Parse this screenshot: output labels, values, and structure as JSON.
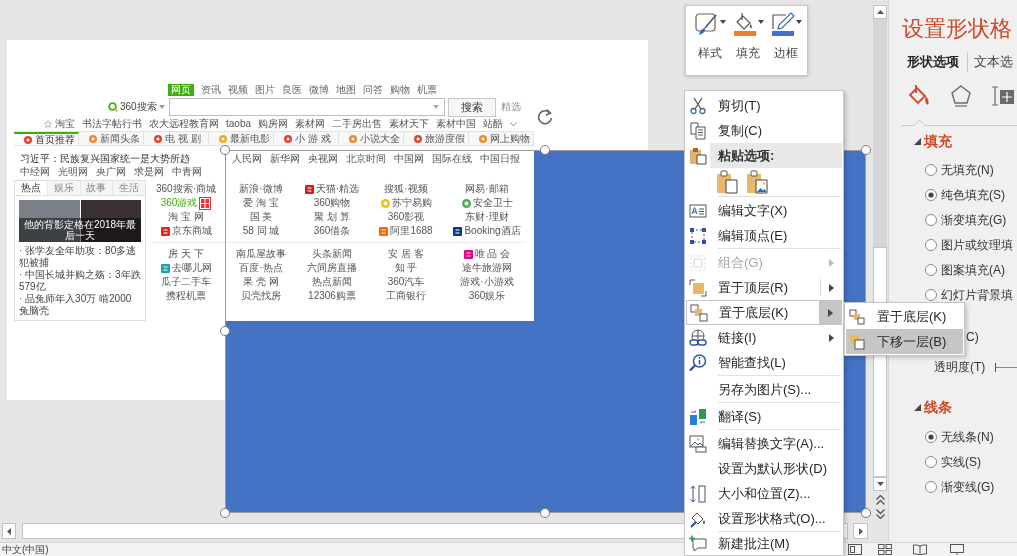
{
  "mini_toolbar": {
    "buttons": [
      {
        "kind": "style",
        "label": "样式"
      },
      {
        "kind": "fill",
        "label": "填充"
      },
      {
        "kind": "outline",
        "label": "边框"
      }
    ]
  },
  "slide": {
    "picture": {
      "nav_tabs": [
        {
          "label": "网页",
          "selected": true
        },
        {
          "label": "资讯",
          "selected": false
        },
        {
          "label": "视频",
          "selected": false
        },
        {
          "label": "图片",
          "selected": false
        },
        {
          "label": "良医",
          "selected": false
        },
        {
          "label": "微博",
          "selected": false
        },
        {
          "label": "地图",
          "selected": false
        },
        {
          "label": "问答",
          "selected": false
        },
        {
          "label": "购物",
          "selected": false
        },
        {
          "label": "机票",
          "selected": false
        }
      ],
      "search": {
        "logo": "360搜索",
        "button": "搜索",
        "side_link": "精选"
      },
      "hot_links": [
        "淘宝",
        "书法字帖行书",
        "农大远程教育网",
        "taoba",
        "购房网",
        "素材网",
        "二手房出售",
        "素材天下",
        "素材中国",
        "站酷"
      ],
      "channel_tabs": [
        {
          "label": "首页推荐",
          "selected": true
        },
        {
          "label": "新闻头条",
          "selected": false
        },
        {
          "label": "电 视 剧",
          "selected": false
        },
        {
          "label": "最新电影",
          "selected": false
        },
        {
          "label": "小 游 戏",
          "selected": false
        },
        {
          "label": "小说大全",
          "selected": false
        },
        {
          "label": "旅游度假",
          "selected": false
        },
        {
          "label": "网上购物",
          "selected": false
        }
      ],
      "headline": "习近平：民族复兴国家统一是大势所趋",
      "media_links": [
        "人民网",
        "新华网",
        "央视网",
        "北京时间",
        "中国网",
        "国际在线",
        "中国日报",
        "中经网",
        "光明网",
        "央广网",
        "求是网",
        "中青网"
      ],
      "news_tabs": [
        {
          "label": "热点",
          "selected": true
        },
        {
          "label": "娱乐",
          "selected": false
        },
        {
          "label": "故事",
          "selected": false
        },
        {
          "label": "生活",
          "selected": false
        }
      ],
      "photo_caption": "他的背影定格在2018年最后一天",
      "news_items": [
        "· 张学友全年助攻：80多逃犯被捕",
        "· 中国长城并购之殇：3年跌579亿",
        "· 品兔师年入30万 啃2000兔脑壳"
      ],
      "site_blocks": [
        [
          [
            {
              "label": "360搜索·商城",
              "highlighted": false
            },
            {
              "label": "新浪·微博",
              "highlighted": false
            },
            {
              "label": "天猫·精选",
              "highlighted": false
            },
            {
              "label": "搜狐·视频",
              "highlighted": false
            },
            {
              "label": "网易·邮箱",
              "highlighted": false
            }
          ],
          [
            {
              "label": "360游戏",
              "highlighted": true
            },
            {
              "label": "爱 淘 宝",
              "highlighted": false
            },
            {
              "label": "360购物",
              "highlighted": false
            },
            {
              "label": "苏宁易购",
              "highlighted": false
            },
            {
              "label": "安全卫士",
              "highlighted": false
            }
          ],
          [
            {
              "label": "淘 宝 网",
              "highlighted": false
            },
            {
              "label": "国 美",
              "highlighted": false
            },
            {
              "label": "聚 划 算",
              "highlighted": false
            },
            {
              "label": "360影视",
              "highlighted": false
            },
            {
              "label": "东财·理财",
              "highlighted": false
            }
          ],
          [
            {
              "label": "京东商城",
              "highlighted": false
            },
            {
              "label": "58 同 城",
              "highlighted": false
            },
            {
              "label": "360借条",
              "highlighted": false
            },
            {
              "label": "阿里1688",
              "highlighted": false
            },
            {
              "label": "Booking酒店",
              "highlighted": false
            }
          ]
        ],
        [
          [
            {
              "label": "房 天 下",
              "highlighted": false
            },
            {
              "label": "南瓜屋故事",
              "highlighted": false
            },
            {
              "label": "头条新闻",
              "highlighted": false
            },
            {
              "label": "安 居 客",
              "highlighted": false
            },
            {
              "label": "唯 品 会",
              "highlighted": false
            }
          ],
          [
            {
              "label": "去哪儿网",
              "highlighted": false
            },
            {
              "label": "百度·热点",
              "highlighted": false
            },
            {
              "label": "六间房直播",
              "highlighted": false
            },
            {
              "label": "知 乎",
              "highlighted": false
            },
            {
              "label": "途牛旅游网",
              "highlighted": false
            }
          ],
          [
            {
              "label": "瓜子二手车",
              "highlighted": false
            },
            {
              "label": "果 壳 网",
              "highlighted": false
            },
            {
              "label": "热点新闻",
              "highlighted": false
            },
            {
              "label": "360汽车",
              "highlighted": false
            },
            {
              "label": "游戏·小游戏",
              "highlighted": false
            }
          ],
          [
            {
              "label": "携程机票",
              "highlighted": false
            },
            {
              "label": "贝壳找房",
              "highlighted": false
            },
            {
              "label": "12306购票",
              "highlighted": false
            },
            {
              "label": "工商银行",
              "highlighted": false
            },
            {
              "label": "360娱乐",
              "highlighted": false
            }
          ]
        ]
      ]
    }
  },
  "context_menu": {
    "groups": [
      [
        {
          "kind": "command",
          "label": "剪切(T)",
          "disabled": false,
          "submenu": false,
          "expanded": false
        },
        {
          "kind": "command",
          "label": "复制(C)",
          "disabled": false,
          "submenu": false,
          "expanded": false
        },
        {
          "kind": "header",
          "label": "粘贴选项:"
        },
        {
          "kind": "paste_options"
        }
      ],
      [
        {
          "kind": "command",
          "label": "编辑文字(X)",
          "disabled": false,
          "submenu": false,
          "expanded": false
        },
        {
          "kind": "command",
          "label": "编辑顶点(E)",
          "disabled": false,
          "submenu": false,
          "expanded": false
        }
      ],
      [
        {
          "kind": "command",
          "label": "组合(G)",
          "disabled": true,
          "submenu": true,
          "expanded": false
        },
        {
          "kind": "split",
          "label": "置于顶层(R)",
          "disabled": false,
          "submenu": true,
          "expanded": false
        },
        {
          "kind": "split",
          "label": "置于底层(K)",
          "disabled": false,
          "submenu": true,
          "expanded": true
        },
        {
          "kind": "command",
          "label": "链接(I)",
          "disabled": false,
          "submenu": true,
          "expanded": false
        },
        {
          "kind": "command",
          "label": "智能查找(L)",
          "disabled": false,
          "submenu": false,
          "expanded": false
        }
      ],
      [
        {
          "kind": "command",
          "label": "另存为图片(S)...",
          "disabled": false,
          "submenu": false,
          "expanded": false
        }
      ],
      [
        {
          "kind": "command",
          "label": "翻译(S)",
          "disabled": false,
          "submenu": false,
          "expanded": false
        }
      ],
      [
        {
          "kind": "command",
          "label": "编辑替换文字(A)...",
          "disabled": false,
          "submenu": false,
          "expanded": false
        },
        {
          "kind": "command",
          "label": "设置为默认形状(D)",
          "disabled": false,
          "submenu": false,
          "expanded": false
        },
        {
          "kind": "command",
          "label": "大小和位置(Z)...",
          "disabled": false,
          "submenu": false,
          "expanded": false
        },
        {
          "kind": "command",
          "label": "设置形状格式(O)...",
          "disabled": false,
          "submenu": false,
          "expanded": false
        }
      ],
      [
        {
          "kind": "command",
          "label": "新建批注(M)",
          "disabled": false,
          "submenu": false,
          "expanded": false
        }
      ]
    ]
  },
  "submenu": {
    "items": [
      {
        "label": "置于底层(K)",
        "selected": false
      },
      {
        "label": "下移一层(B)",
        "selected": true
      }
    ]
  },
  "format_pane": {
    "title": "设置形状格",
    "tabs": [
      {
        "label": "形状选项",
        "selected": true
      },
      {
        "label": "文本选",
        "selected": false
      }
    ],
    "category_tabs": [
      {
        "selected": true
      },
      {
        "selected": false
      },
      {
        "selected": false
      }
    ],
    "sections": [
      {
        "title": "填充",
        "expanded": true,
        "options": [
          {
            "label": "无填充(N)",
            "selected": false
          },
          {
            "label": "纯色填充(S)",
            "selected": true
          },
          {
            "label": "渐变填充(G)",
            "selected": false
          },
          {
            "label": "图片或纹理填",
            "selected": false
          },
          {
            "label": "图案填充(A)",
            "selected": false
          },
          {
            "label": "幻灯片背景填",
            "selected": false
          }
        ],
        "controls": [
          {
            "kind": "color",
            "label": "C)"
          },
          {
            "kind": "slider",
            "label": "透明度(T)"
          }
        ]
      },
      {
        "title": "线条",
        "expanded": true,
        "options": [
          {
            "label": "无线条(N)",
            "selected": true
          },
          {
            "label": "实线(S)",
            "selected": false
          },
          {
            "label": "渐变线(G)",
            "selected": false
          }
        ]
      }
    ]
  },
  "status_bar": {
    "language": "中文(中国)"
  }
}
